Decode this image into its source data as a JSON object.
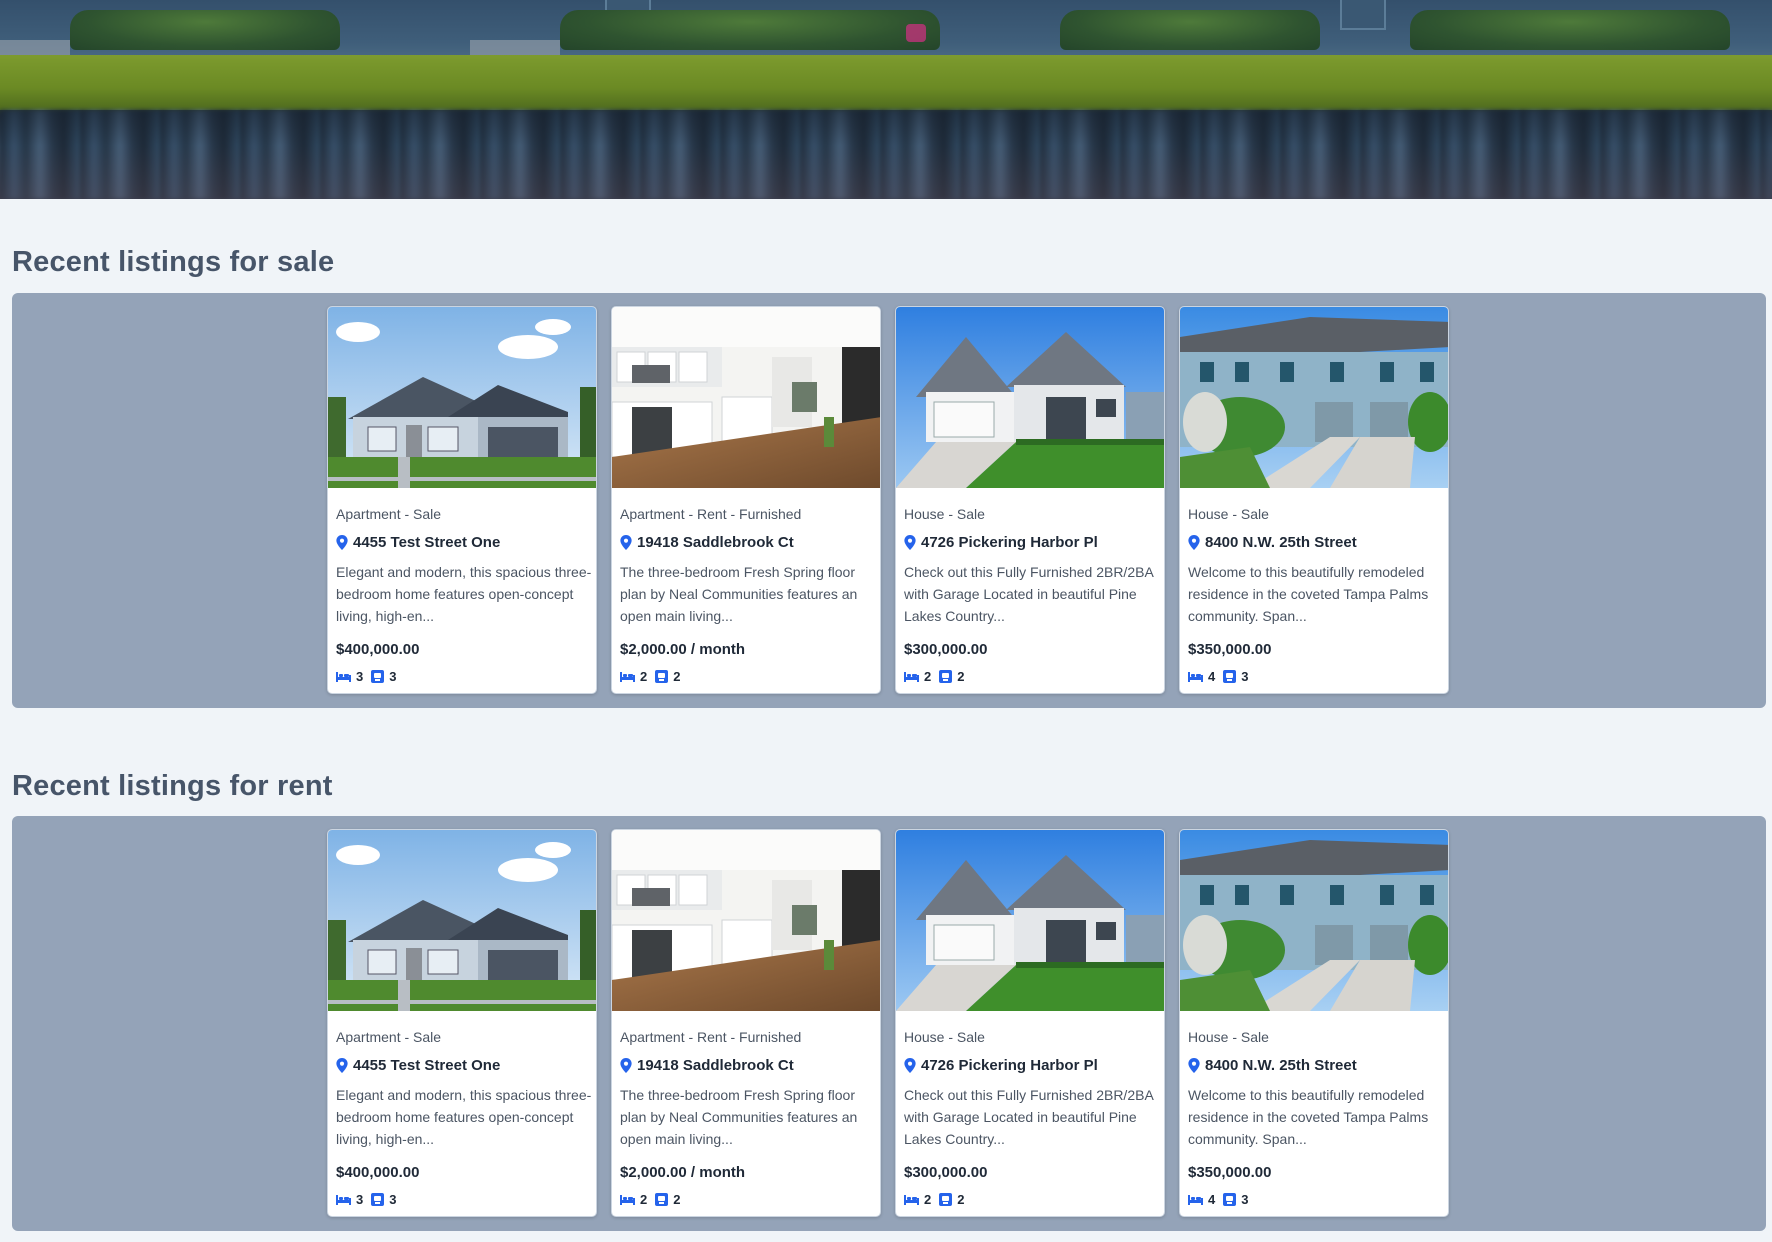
{
  "sections": [
    {
      "title": "Recent listings for sale",
      "listings": [
        {
          "type": "Apartment - Sale",
          "address": "4455 Test Street One",
          "description": "Elegant and modern, this spacious three-bedroom home features open-concept living, high-en...",
          "price": "$400,000.00",
          "beds": "3",
          "baths": "3"
        },
        {
          "type": "Apartment - Rent - Furnished",
          "address": "19418 Saddlebrook Ct",
          "description": "The three-bedroom Fresh Spring floor plan by Neal Communities features an open main living...",
          "price": "$2,000.00 / month",
          "beds": "2",
          "baths": "2"
        },
        {
          "type": "House - Sale",
          "address": "4726 Pickering Harbor Pl",
          "description": "Check out this Fully Furnished 2BR/2BA with Garage Located in beautiful Pine Lakes Country...",
          "price": "$300,000.00",
          "beds": "2",
          "baths": "2"
        },
        {
          "type": "House - Sale",
          "address": "8400 N.W. 25th Street",
          "description": "Welcome to this beautifully remodeled residence in the coveted Tampa Palms community. Span...",
          "price": "$350,000.00",
          "beds": "4",
          "baths": "3"
        }
      ]
    },
    {
      "title": "Recent listings for rent",
      "listings": [
        {
          "type": "Apartment - Sale",
          "address": "4455 Test Street One",
          "description": "Elegant and modern, this spacious three-bedroom home features open-concept living, high-en...",
          "price": "$400,000.00",
          "beds": "3",
          "baths": "3"
        },
        {
          "type": "Apartment - Rent - Furnished",
          "address": "19418 Saddlebrook Ct",
          "description": "The three-bedroom Fresh Spring floor plan by Neal Communities features an open main living...",
          "price": "$2,000.00 / month",
          "beds": "2",
          "baths": "2"
        },
        {
          "type": "House - Sale",
          "address": "4726 Pickering Harbor Pl",
          "description": "Check out this Fully Furnished 2BR/2BA with Garage Located in beautiful Pine Lakes Country...",
          "price": "$300,000.00",
          "beds": "2",
          "baths": "2"
        },
        {
          "type": "House - Sale",
          "address": "8400 N.W. 25th Street",
          "description": "Welcome to this beautifully remodeled residence in the coveted Tampa Palms community. Span...",
          "price": "$350,000.00",
          "beds": "4",
          "baths": "3"
        }
      ]
    }
  ],
  "colors": {
    "accent": "#2563eb",
    "band": "#94a3b8",
    "page": "#f0f4f8",
    "heading": "#475569"
  },
  "icons": {
    "address": "map-pin-icon",
    "beds": "bed-icon",
    "baths": "bath-icon"
  }
}
